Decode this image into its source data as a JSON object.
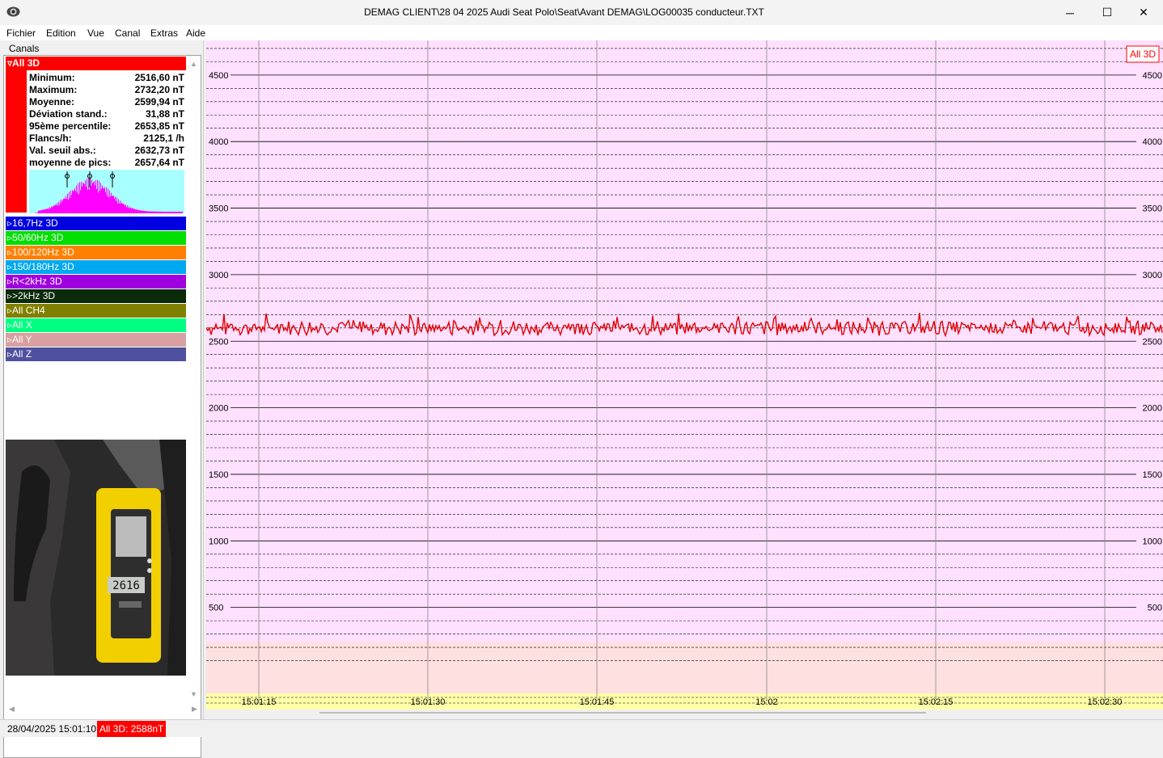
{
  "window": {
    "title": "DEMAG CLIENT\\28 04 2025 Audi Seat Polo\\Seat\\Avant DEMAG\\LOG00035 conducteur.TXT",
    "minimize": "─",
    "maximize": "☐",
    "close": "✕"
  },
  "menu": [
    "Fichier",
    "Edition",
    "Vue",
    "Canal",
    "Extras",
    "Aide"
  ],
  "panel": {
    "title": "Canals",
    "active_channel": {
      "label": "All 3D",
      "color": "#ff0000",
      "stats": [
        {
          "label": "Minimum:",
          "value": "2516,60 nT"
        },
        {
          "label": "Maximum:",
          "value": "2732,20 nT"
        },
        {
          "label": "Moyenne:",
          "value": "2599,94 nT"
        },
        {
          "label": "Déviation stand.:",
          "value": "31,88 nT"
        },
        {
          "label": "95ème percentile:",
          "value": "2653,85 nT"
        },
        {
          "label": "Flancs/h:",
          "value": "2125,1 /h"
        },
        {
          "label": "Val. seuil abs.:",
          "value": "2632,73 nT"
        },
        {
          "label": "moyenne de pics:",
          "value": "2657,64 nT"
        }
      ]
    },
    "channels": [
      {
        "label": "16,7Hz 3D",
        "color": "#0000e0"
      },
      {
        "label": "50/60Hz 3D",
        "color": "#00e000"
      },
      {
        "label": "100/120Hz 3D",
        "color": "#ff8000"
      },
      {
        "label": "150/180Hz 3D",
        "color": "#00a8f0"
      },
      {
        "label": "R<2kHz 3D",
        "color": "#a000e0"
      },
      {
        "label": ">2kHz 3D",
        "color": "#0a2a0a"
      },
      {
        "label": "All CH4",
        "color": "#808000"
      },
      {
        "label": "All X",
        "color": "#00ff80"
      },
      {
        "label": "All Y",
        "color": "#d8a0a0"
      },
      {
        "label": "All Z",
        "color": "#5050a0"
      }
    ]
  },
  "chart_data": {
    "type": "line",
    "legend_label": "All 3D",
    "series": [
      {
        "name": "All 3D",
        "color": "#e00000",
        "mean": 2600
      }
    ],
    "yticks": [
      500,
      1000,
      1500,
      2000,
      2500,
      3000,
      3500,
      4000,
      4500
    ],
    "ylim": [
      0,
      4800
    ],
    "xticks": [
      "15:01:15",
      "15:01:30",
      "15:01:45",
      "15:02",
      "15:02:15",
      "15:02:30"
    ]
  },
  "status": {
    "timestamp": "28/04/2025 15:01:10",
    "value": "All 3D: 2588nT"
  }
}
